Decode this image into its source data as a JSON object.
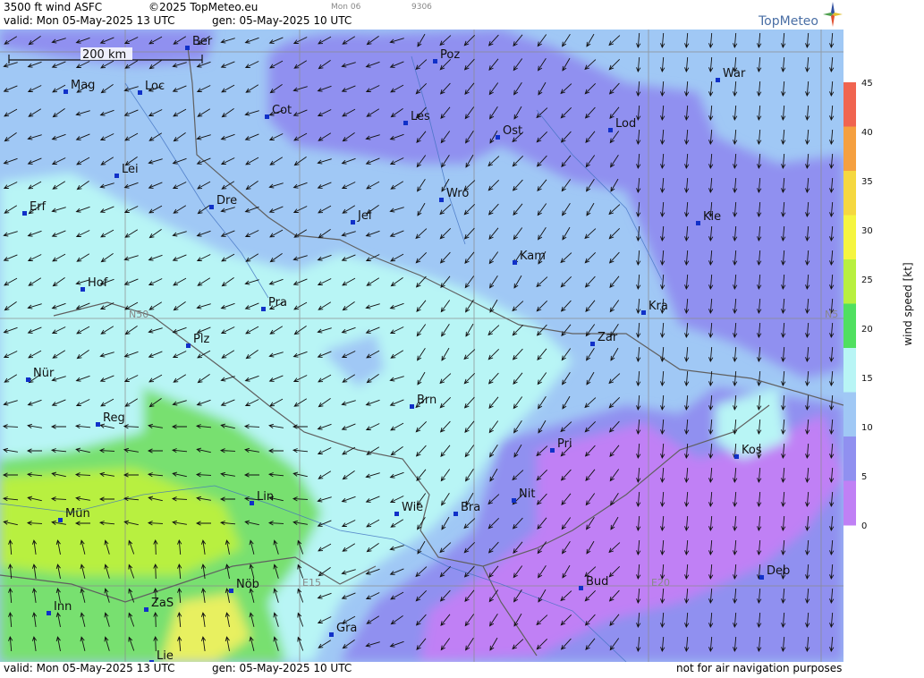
{
  "header": {
    "line1_product": "3500 ft wind ASFC",
    "line1_copyright": "©2025 TopMeteo.eu",
    "line1_day": "Mon 06",
    "line1_code": "9306",
    "line2_valid": "valid:  Mon  05-May-2025  13 UTC",
    "line2_gen": "gen:  05-May-2025 10 UTC",
    "logo_text": "TopMeteo"
  },
  "footer": {
    "valid": "valid:  Mon  05-May-2025  13 UTC",
    "gen": "gen:  05-May-2025 10 UTC",
    "disclaimer": "not for air navigation purposes"
  },
  "scale_bar": {
    "label": "200 km"
  },
  "grid_labels": {
    "n50": "N50",
    "n50_right": "N5",
    "e15": "E15",
    "e20": "E20"
  },
  "legend": {
    "title": "wind  speed  [kt]",
    "ticks": [
      "45",
      "40",
      "35",
      "30",
      "25",
      "20",
      "15",
      "10",
      "5",
      "0"
    ],
    "colors": [
      "#f06450",
      "#f5a040",
      "#f5d840",
      "#f5f540",
      "#b8f040",
      "#50e060",
      "#b8f5f5",
      "#a0c8f5",
      "#9090f0",
      "#c080f5"
    ]
  },
  "cities": [
    {
      "name": "Ber"
    },
    {
      "name": "Poz"
    },
    {
      "name": "War"
    },
    {
      "name": "Mag"
    },
    {
      "name": "Loc"
    },
    {
      "name": "Cot"
    },
    {
      "name": "Les"
    },
    {
      "name": "Ost"
    },
    {
      "name": "Lod"
    },
    {
      "name": "Lei"
    },
    {
      "name": "Erf"
    },
    {
      "name": "Dre"
    },
    {
      "name": "Wro"
    },
    {
      "name": "Jel"
    },
    {
      "name": "Kie"
    },
    {
      "name": "Kam"
    },
    {
      "name": "Hof"
    },
    {
      "name": "Pra"
    },
    {
      "name": "Kra"
    },
    {
      "name": "Zar"
    },
    {
      "name": "Plz"
    },
    {
      "name": "Nür"
    },
    {
      "name": "Brn"
    },
    {
      "name": "Reg"
    },
    {
      "name": "Pri"
    },
    {
      "name": "Kos"
    },
    {
      "name": "Lin"
    },
    {
      "name": "Nit"
    },
    {
      "name": "Mün"
    },
    {
      "name": "Wie"
    },
    {
      "name": "Bra"
    },
    {
      "name": "Bud"
    },
    {
      "name": "Deb"
    },
    {
      "name": "Nöb"
    },
    {
      "name": "Inn"
    },
    {
      "name": "ZaS"
    },
    {
      "name": "Gra"
    },
    {
      "name": "Lie"
    }
  ]
}
